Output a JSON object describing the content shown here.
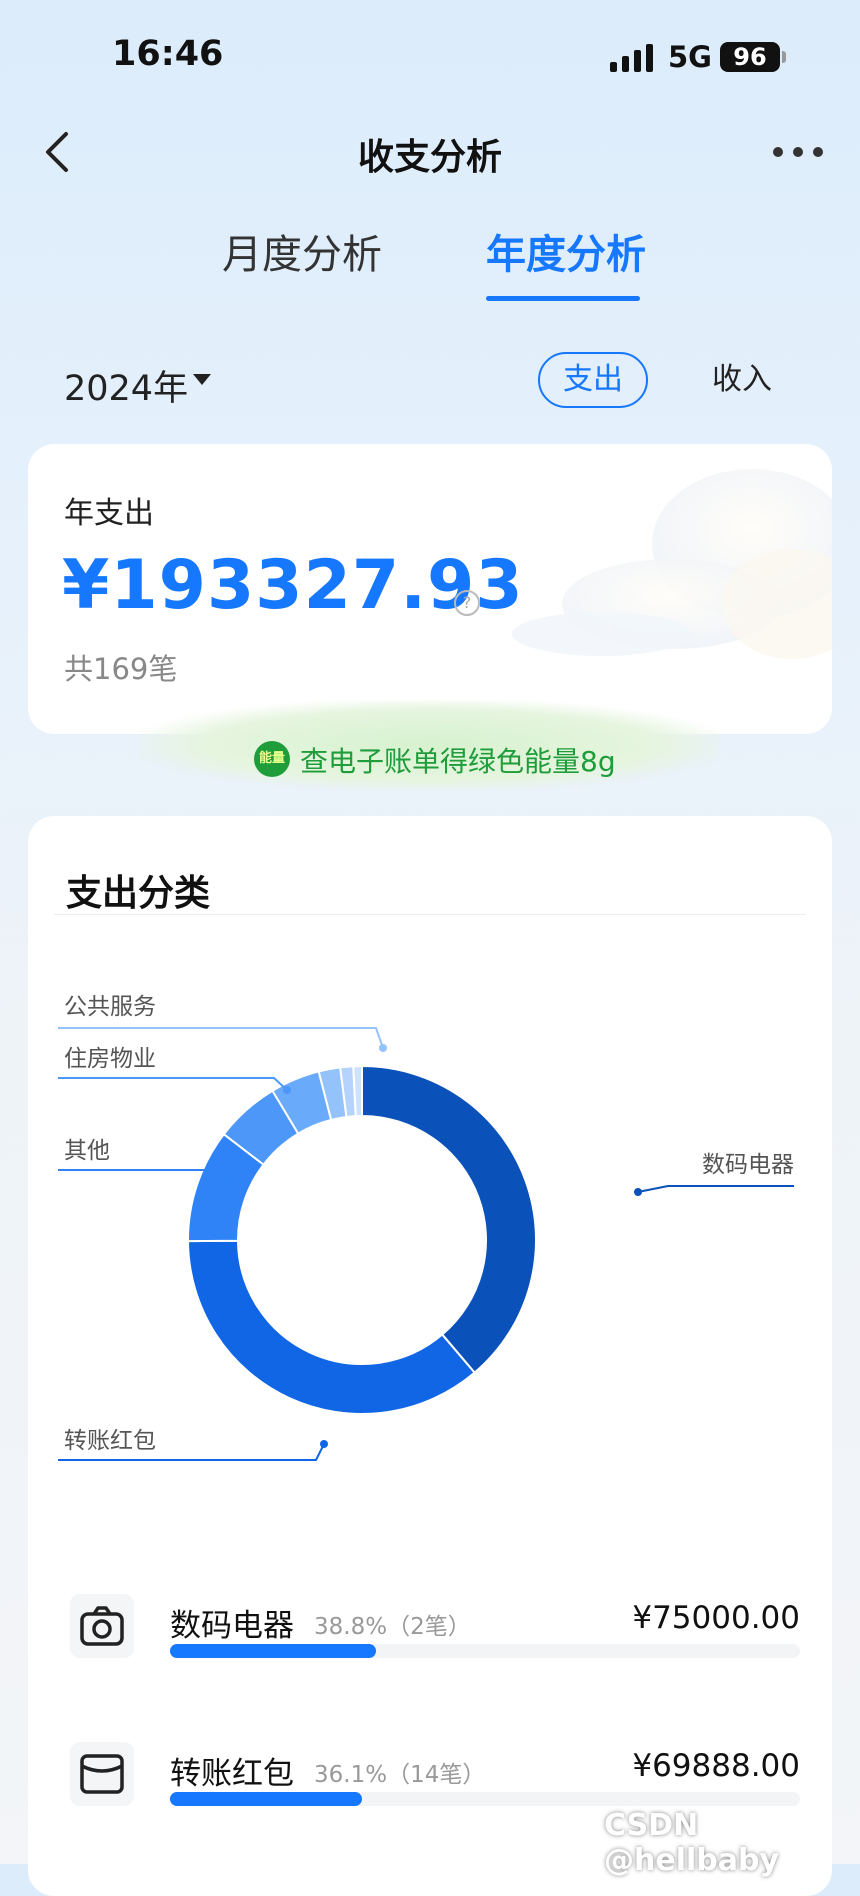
{
  "status_bar": {
    "time": "16:46",
    "network": "5G",
    "battery": "96"
  },
  "nav": {
    "title": "收支分析"
  },
  "tabs": [
    {
      "label": "月度分析"
    },
    {
      "label": "年度分析"
    }
  ],
  "filters": {
    "year": "2024年",
    "expense": "支出",
    "income": "收入"
  },
  "summary": {
    "label": "年支出",
    "amount": "¥193327.93",
    "count": "共169笔",
    "energy_badge": "能量",
    "energy_text": "查电子账单得绿色能量8g"
  },
  "category": {
    "title": "支出分类"
  },
  "chart_data": {
    "type": "pie",
    "donut": true,
    "slices": [
      {
        "label": "数码电器",
        "percent": 38.8,
        "color": "#0a52b9"
      },
      {
        "label": "转账红包",
        "percent": 36.1,
        "color": "#1166e6"
      },
      {
        "label": "其他",
        "percent": 10.5,
        "color": "#2f83f6"
      },
      {
        "label": "住房物业",
        "percent": 6.0,
        "color": "#4d97f8"
      },
      {
        "label": "",
        "percent": 4.6,
        "color": "#6aaafa"
      },
      {
        "label": "公共服务",
        "percent": 2.0,
        "color": "#94c2fb"
      },
      {
        "label": "",
        "percent": 1.2,
        "color": "#b5d3fc"
      },
      {
        "label": "",
        "percent": 0.8,
        "color": "#cfe2fd"
      }
    ]
  },
  "list": [
    {
      "name": "数码电器",
      "meta": "38.8%（2笔）",
      "amount": "¥75000.00",
      "percent": 38.8,
      "icon": "camera-icon"
    },
    {
      "name": "转账红包",
      "meta": "36.1%（14笔）",
      "amount": "¥69888.00",
      "percent": 36.1,
      "icon": "wallet-icon"
    }
  ],
  "watermark": "CSDN @hellbaby"
}
